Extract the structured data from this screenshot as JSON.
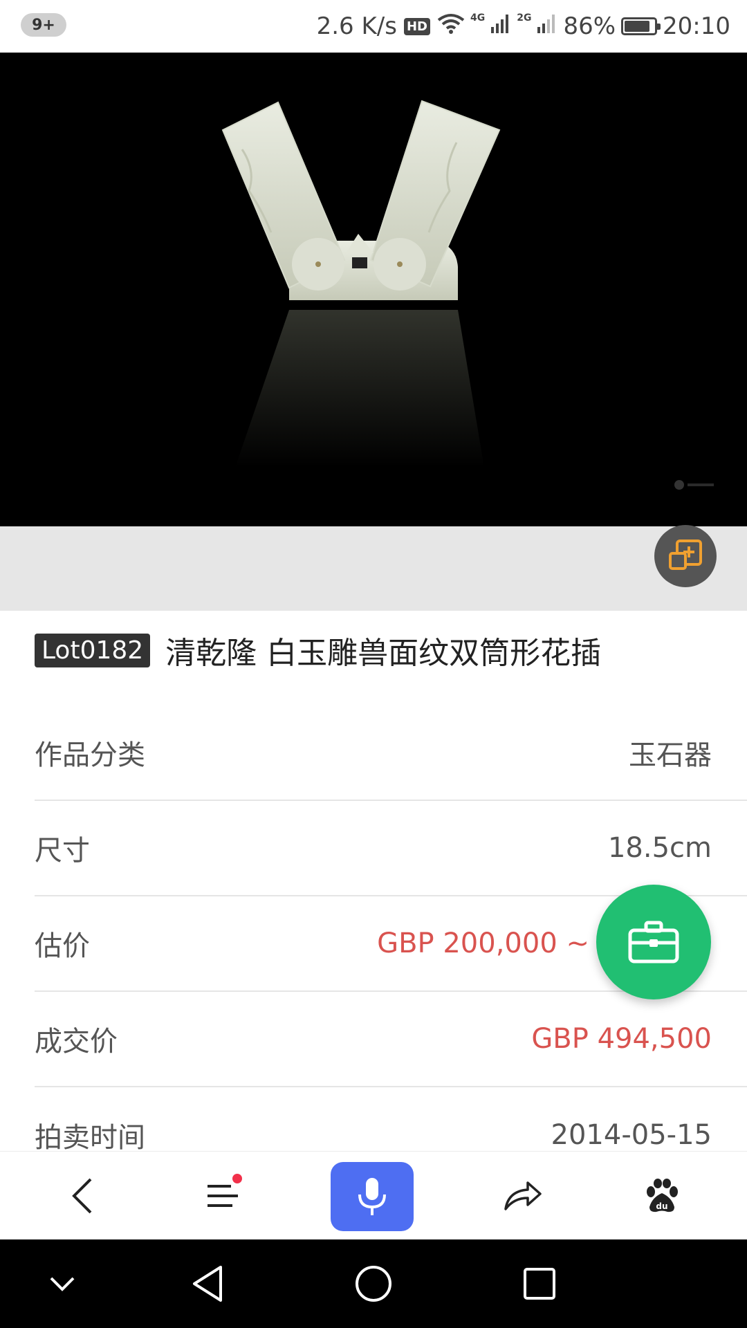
{
  "status_bar": {
    "notification_count": "9+",
    "net_speed": "2.6 K/s",
    "hd_label": "HD",
    "network_1": "4G",
    "network_2": "2G",
    "battery_percent": "86%",
    "battery_level": 0.86,
    "time": "20:10"
  },
  "hero": {
    "image_subject": "white-jade-double-vase-photo",
    "zoom_icon": "add-to-collection-icon"
  },
  "lot": {
    "badge": "Lot0182",
    "title": "清乾隆 白玉雕兽面纹双筒形花插"
  },
  "details": [
    {
      "label": "作品分类",
      "value": "玉石器",
      "highlight": false
    },
    {
      "label": "尺寸",
      "value": "18.5cm",
      "highlight": false
    },
    {
      "label": "估价",
      "value": "GBP 200,000 ~",
      "highlight": true
    },
    {
      "label": "成交价",
      "value": "GBP 494,500",
      "highlight": true
    },
    {
      "label": "拍卖时间",
      "value": "2014-05-15",
      "highlight": false
    }
  ],
  "fab": {
    "icon": "briefcase-icon"
  },
  "toolbar": {
    "items": [
      "back-icon",
      "menu-icon",
      "mic-icon",
      "share-icon",
      "baidu-paw-icon"
    ],
    "menu_has_badge": true
  },
  "nav_bar": {
    "items": [
      "chevron-down-icon",
      "back-triangle-icon",
      "home-circle-icon",
      "recents-square-icon"
    ]
  },
  "colors": {
    "accent_red": "#d9534f",
    "fab_green": "#21bf72",
    "mic_blue": "#4e6ef2"
  }
}
